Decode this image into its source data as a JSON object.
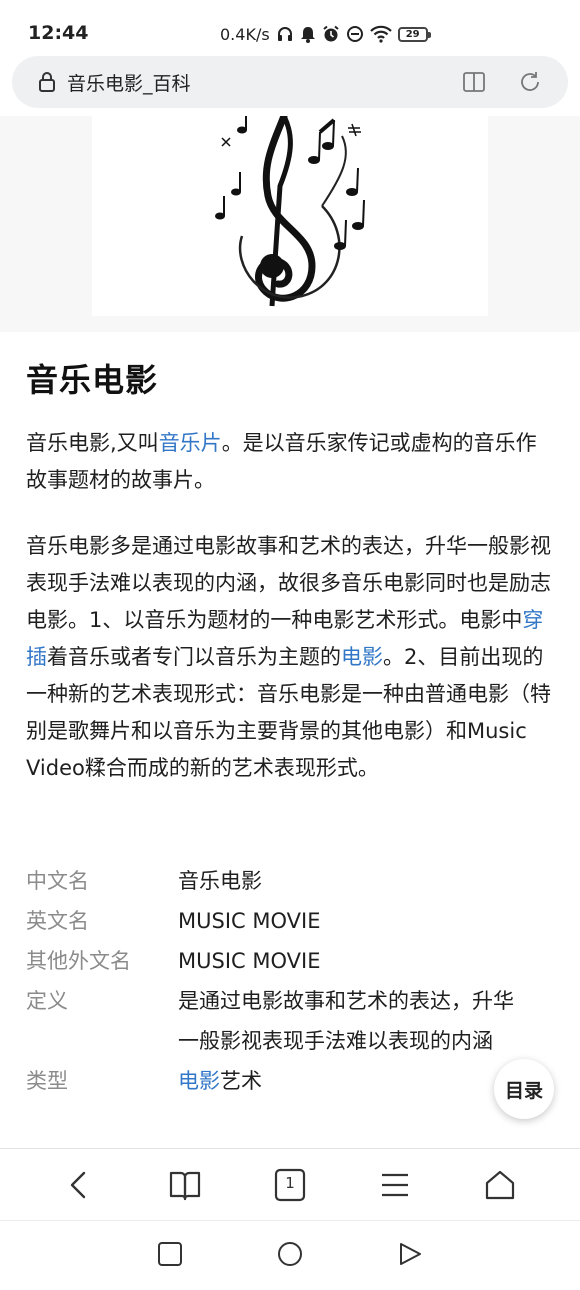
{
  "status_bar": {
    "time": "12:44",
    "network_speed": "0.4K/s",
    "icons": [
      "headphones-icon",
      "bell-icon",
      "alarm-icon",
      "do-not-disturb-icon",
      "wifi-icon"
    ],
    "battery": "29"
  },
  "address_bar": {
    "title": "音乐电影_百科",
    "icons": [
      "lock-icon",
      "reader-mode-icon",
      "refresh-icon"
    ]
  },
  "article": {
    "title": "音乐电影",
    "intro": {
      "before_link": "音乐电影,又叫",
      "link": "音乐片",
      "after_link": "。是以音乐家传记或虚构的音乐作故事题材的故事片。"
    },
    "body": {
      "part1": "音乐电影多是通过电影故事和艺术的表达，升华一般影视表现手法难以表现的内涵，故很多音乐电影同时也是励志电影。1、以音乐为题材的一种电影艺术形式。电影中",
      "link1": "穿插",
      "part2": "着音乐或者专门以音乐为主题的",
      "link2": "电影",
      "part3": "。2、目前出现的一种新的艺术表现形式：音乐电影是一种由普通电影（特别是歌舞片和以音乐为主要背景的其他电影）和Music Video糅合而成的新的艺术表现形式。"
    },
    "info": [
      {
        "label": "中文名",
        "value": "音乐电影"
      },
      {
        "label": "英文名",
        "value": "MUSIC MOVIE"
      },
      {
        "label": "其他外文名",
        "value": "MUSIC MOVIE"
      },
      {
        "label": "定义",
        "value": "是通过电影故事和艺术的表达，升华一般影视表现手法难以表现的内涵"
      },
      {
        "label": "类型",
        "value_link": "电影",
        "value_rest": "艺术"
      }
    ]
  },
  "toc_button": "目录",
  "toolbar": {
    "tab_count": "1",
    "icons": [
      "back-icon",
      "bookmarks-icon",
      "tabs-icon",
      "menu-icon",
      "home-icon"
    ]
  },
  "system_nav": {
    "icons": [
      "recent-apps-icon",
      "home-circle-icon",
      "back-triangle-icon"
    ]
  },
  "colors": {
    "link": "#3277c7",
    "label_gray": "#8b8b8b",
    "address_bg": "#eef0f2"
  }
}
